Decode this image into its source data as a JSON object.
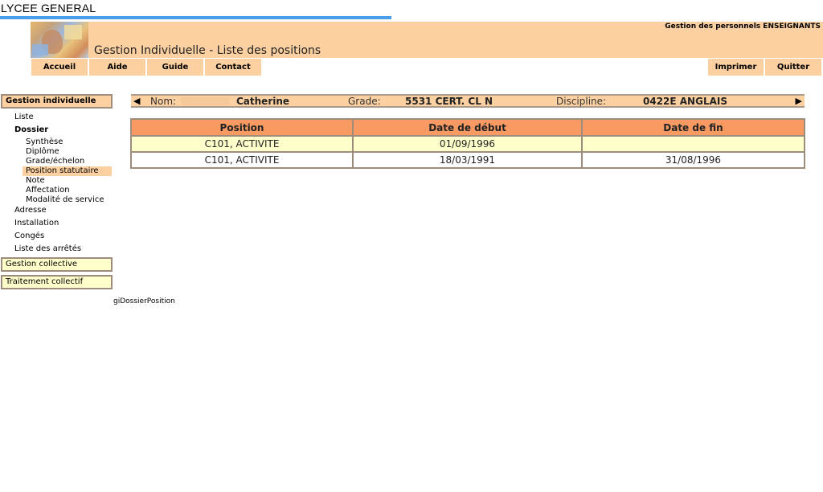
{
  "school": {
    "title": "LYCEE GENERAL"
  },
  "header": {
    "right_label": "Gestion des personnels ENSEIGNANTS",
    "page_title": "Gestion Individuelle - Liste des positions"
  },
  "menu": {
    "accueil": "Accueil",
    "aide": "Aide",
    "guide": "Guide",
    "contact": "Contact",
    "imprimer": "Imprimer",
    "quitter": "Quitter"
  },
  "sidebar": {
    "gestion_individuelle": "Gestion individuelle",
    "liste": "Liste",
    "dossier": "Dossier",
    "dossier_items": [
      "Synthèse",
      "Diplôme",
      "Grade/échelon",
      "Position statutaire",
      "Note",
      "Affectation",
      "Modalité de service"
    ],
    "adresse": "Adresse",
    "installation": "Installation",
    "conges": "Congés",
    "liste_arretes": "Liste des arrêtés",
    "gestion_collective": "Gestion collective",
    "traitement_collectif": "Traitement collectif"
  },
  "agent": {
    "prev_icon": "arrow-left-icon",
    "next_icon": "arrow-right-icon",
    "nom_label": "Nom:",
    "nom_value": "Catherine",
    "grade_label": "Grade:",
    "grade_value": "5531 CERT. CL N",
    "discipline_label": "Discipline:",
    "discipline_value": "0422E ANGLAIS"
  },
  "table": {
    "headers": [
      "Position",
      "Date de début",
      "Date de fin"
    ],
    "rows": [
      [
        "C101, ACTIVITE",
        "01/09/1996",
        ""
      ],
      [
        "C101, ACTIVITE",
        "18/03/1991",
        "31/08/1996"
      ]
    ]
  },
  "footer": {
    "page_id": "giDossierPosition"
  },
  "colors": {
    "peach": "#fcd0a0",
    "orange_header": "#f99a62",
    "light_yellow": "#ffffcc",
    "blue_line": "#4a9ee8"
  }
}
